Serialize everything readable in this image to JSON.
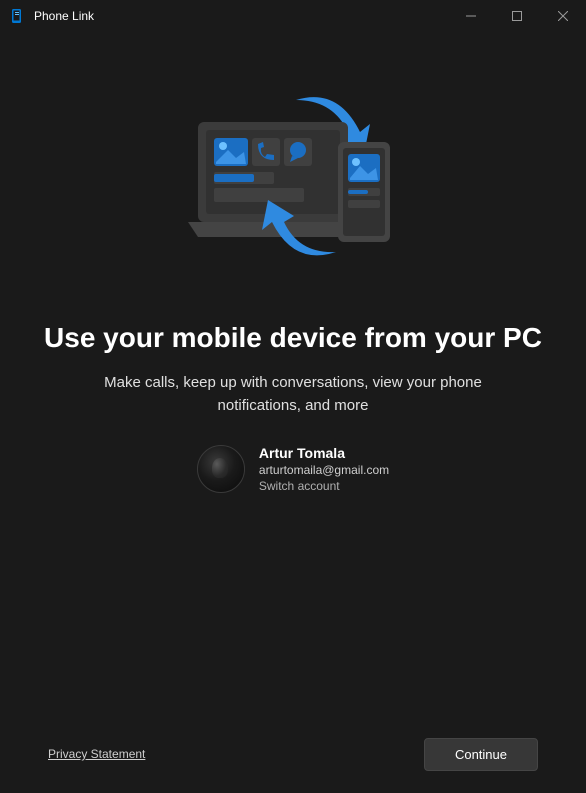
{
  "window": {
    "title": "Phone Link"
  },
  "main": {
    "heading": "Use your mobile device from your PC",
    "subheading": "Make calls, keep up with conversations, view your phone notifications, and more"
  },
  "account": {
    "name": "Artur Tomala",
    "email": "arturtomaila@gmail.com",
    "switch_label": "Switch account"
  },
  "footer": {
    "privacy_label": "Privacy Statement",
    "continue_label": "Continue"
  }
}
